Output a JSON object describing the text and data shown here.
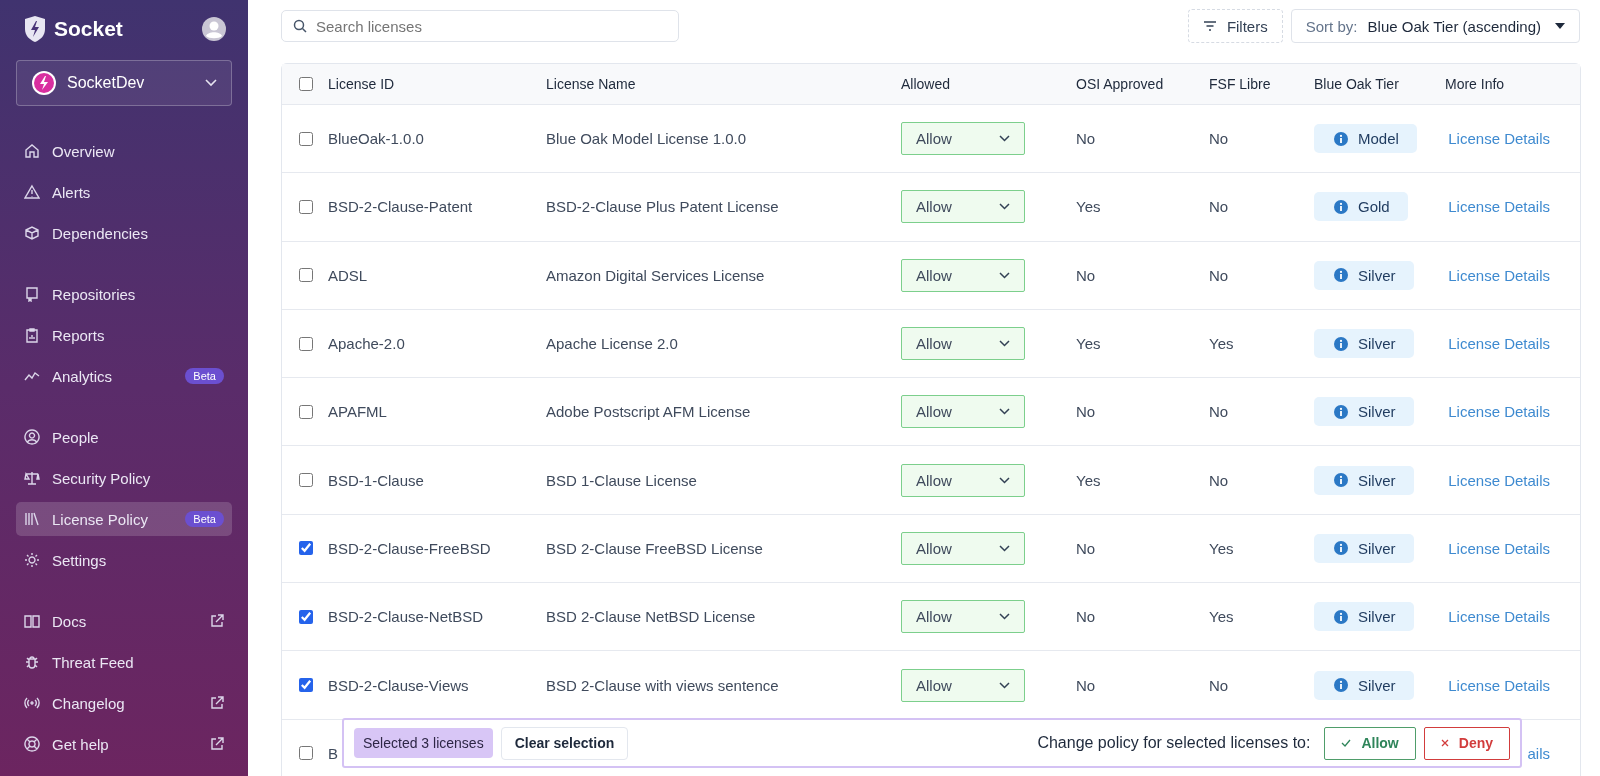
{
  "sidebar": {
    "brand": "Socket",
    "org": "SocketDev",
    "groups": [
      [
        {
          "label": "Overview",
          "selected": false
        },
        {
          "label": "Alerts",
          "selected": false
        },
        {
          "label": "Dependencies",
          "selected": false
        }
      ],
      [
        {
          "label": "Repositories",
          "selected": false
        },
        {
          "label": "Reports",
          "selected": false
        },
        {
          "label": "Analytics",
          "selected": false,
          "badge": "Beta"
        }
      ],
      [
        {
          "label": "People",
          "selected": false
        },
        {
          "label": "Security Policy",
          "selected": false
        },
        {
          "label": "License Policy",
          "selected": true,
          "badge": "Beta"
        },
        {
          "label": "Settings",
          "selected": false
        }
      ],
      [
        {
          "label": "Docs",
          "selected": false,
          "external": true
        },
        {
          "label": "Threat Feed",
          "selected": false
        },
        {
          "label": "Changelog",
          "selected": false,
          "external": true
        },
        {
          "label": "Get help",
          "selected": false,
          "external": true
        }
      ]
    ]
  },
  "search": {
    "placeholder": "Search licenses"
  },
  "filters_button": "Filters",
  "sort": {
    "label": "Sort by:",
    "value": "Blue Oak Tier (ascending)"
  },
  "table": {
    "select_all": false,
    "columns": [
      "License ID",
      "License Name",
      "Allowed",
      "OSI Approved",
      "FSF Libre",
      "Blue Oak Tier",
      "More Info"
    ],
    "rows": [
      {
        "selected": false,
        "id": "BlueOak-1.0.0",
        "name": "Blue Oak Model License 1.0.0",
        "allowed": "Allow",
        "osi": "No",
        "fsf": "No",
        "tier": "Model",
        "link": "License Details"
      },
      {
        "selected": false,
        "id": "BSD-2-Clause-Patent",
        "name": "BSD-2-Clause Plus Patent License",
        "allowed": "Allow",
        "osi": "Yes",
        "fsf": "No",
        "tier": "Gold",
        "link": "License Details"
      },
      {
        "selected": false,
        "id": "ADSL",
        "name": "Amazon Digital Services License",
        "allowed": "Allow",
        "osi": "No",
        "fsf": "No",
        "tier": "Silver",
        "link": "License Details"
      },
      {
        "selected": false,
        "id": "Apache-2.0",
        "name": "Apache License 2.0",
        "allowed": "Allow",
        "osi": "Yes",
        "fsf": "Yes",
        "tier": "Silver",
        "link": "License Details"
      },
      {
        "selected": false,
        "id": "APAFML",
        "name": "Adobe Postscript AFM License",
        "allowed": "Allow",
        "osi": "No",
        "fsf": "No",
        "tier": "Silver",
        "link": "License Details"
      },
      {
        "selected": false,
        "id": "BSD-1-Clause",
        "name": "BSD 1-Clause License",
        "allowed": "Allow",
        "osi": "Yes",
        "fsf": "No",
        "tier": "Silver",
        "link": "License Details"
      },
      {
        "selected": true,
        "id": "BSD-2-Clause-FreeBSD",
        "name": "BSD 2-Clause FreeBSD License",
        "allowed": "Allow",
        "osi": "No",
        "fsf": "Yes",
        "tier": "Silver",
        "link": "License Details"
      },
      {
        "selected": true,
        "id": "BSD-2-Clause-NetBSD",
        "name": "BSD 2-Clause NetBSD License",
        "allowed": "Allow",
        "osi": "No",
        "fsf": "Yes",
        "tier": "Silver",
        "link": "License Details"
      },
      {
        "selected": true,
        "id": "BSD-2-Clause-Views",
        "name": "BSD 2-Clause with views sentence",
        "allowed": "Allow",
        "osi": "No",
        "fsf": "No",
        "tier": "Silver",
        "link": "License Details"
      },
      {
        "selected": false,
        "id": "B",
        "link": "ails"
      }
    ]
  },
  "selection_bar": {
    "count": "Selected 3 licenses",
    "clear": "Clear selection",
    "prompt": "Change policy for selected licenses to:",
    "allow": "Allow",
    "deny": "Deny"
  }
}
